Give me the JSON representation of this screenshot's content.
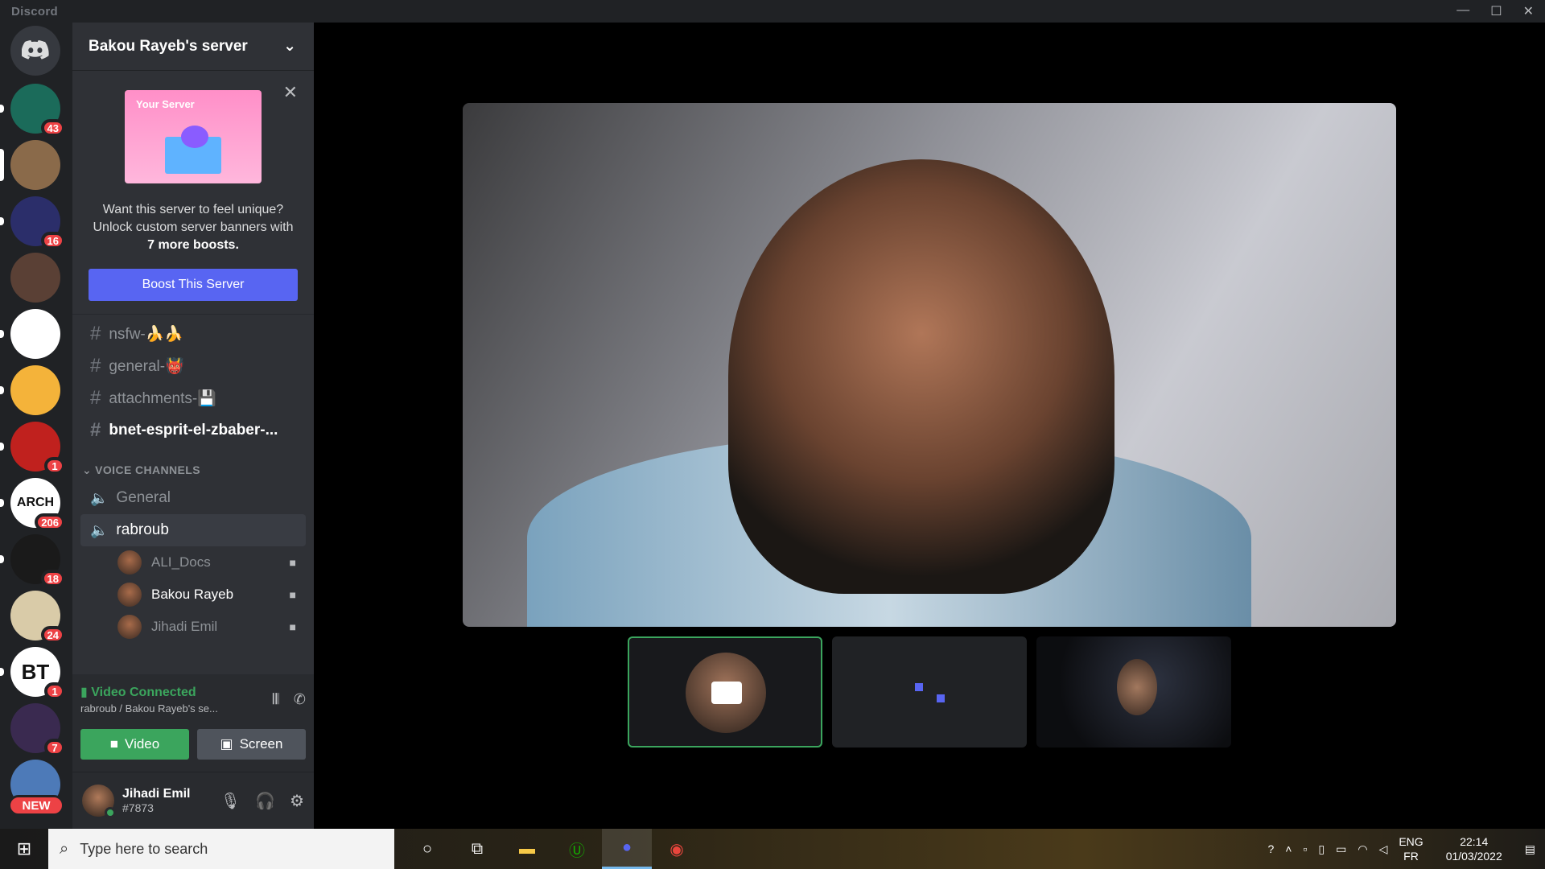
{
  "window": {
    "brand": "Discord"
  },
  "guilds": [
    {
      "badge": "43",
      "color": "#1b6b5a"
    },
    {
      "badge": "",
      "color": "#8a6a4a"
    },
    {
      "badge": "16",
      "color": "#2b2e6a"
    },
    {
      "badge": "",
      "color": "#5a4035"
    },
    {
      "badge": "",
      "color": "#ffffff"
    },
    {
      "badge": "",
      "color": "#f4b33a"
    },
    {
      "badge": "1",
      "color": "#c0211e"
    },
    {
      "badge": "206",
      "color": "#ffffff",
      "text": "ARCH"
    },
    {
      "badge": "18",
      "color": "#1a1a1a"
    },
    {
      "badge": "24",
      "color": "#d9cba8"
    },
    {
      "badge": "1",
      "color": "#ffffff",
      "text": "BT"
    },
    {
      "badge": "7",
      "color": "#3a2a50"
    },
    {
      "badge": "",
      "color": "#4d7ab8"
    }
  ],
  "new_label": "NEW",
  "server": {
    "name": "Bakou Rayeb's server"
  },
  "boost": {
    "banner_title": "Your Server",
    "line1": "Want this server to feel unique?",
    "line2": "Unlock custom server banners with",
    "line3": "7 more boosts.",
    "button": "Boost This Server"
  },
  "text_channels": [
    {
      "name": "nsfw-🍌🍌",
      "unread": false
    },
    {
      "name": "general-👹",
      "unread": false
    },
    {
      "name": "attachments-💾",
      "unread": false
    },
    {
      "name": "bnet-esprit-el-zbaber-...",
      "unread": true
    }
  ],
  "voice_category": "VOICE CHANNELS",
  "voice_channels": [
    {
      "name": "General"
    },
    {
      "name": "rabroub"
    }
  ],
  "voice_users": [
    {
      "name": "ALI_Docs"
    },
    {
      "name": "Bakou Rayeb"
    },
    {
      "name": "Jihadi Emil"
    }
  ],
  "connection": {
    "status": "Video Connected",
    "location": "rabroub / Bakou Rayeb's se...",
    "video_label": "Video",
    "screen_label": "Screen"
  },
  "user": {
    "name": "Jihadi Emil",
    "tag": "#7873"
  },
  "taskbar": {
    "search_placeholder": "Type here to search",
    "lang1": "ENG",
    "lang2": "FR",
    "time": "22:14",
    "date": "01/03/2022"
  },
  "colors": {
    "accent": "#5865f2",
    "green": "#3ba55d",
    "red": "#ed4245"
  }
}
